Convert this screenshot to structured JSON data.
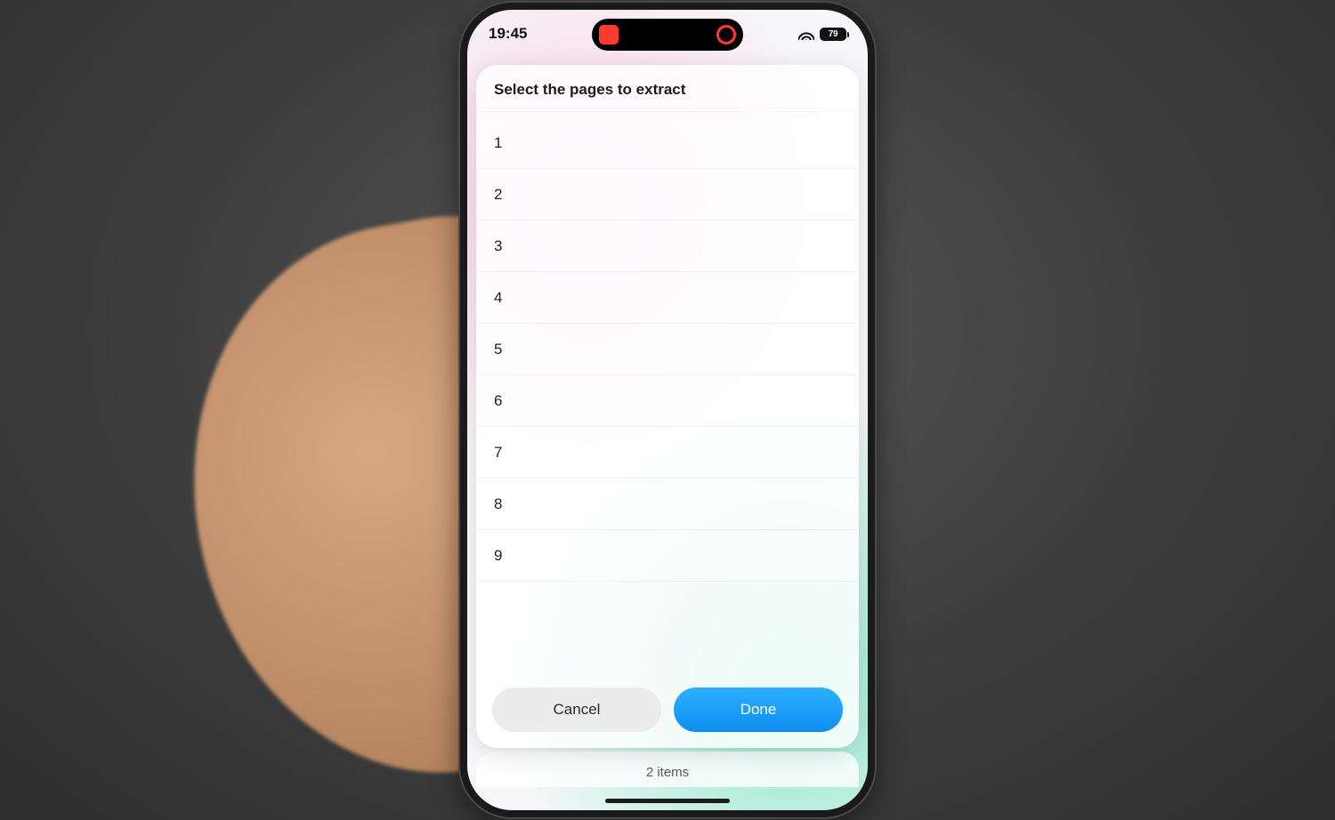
{
  "status": {
    "time": "19:45",
    "battery": "79"
  },
  "modal": {
    "title": "Select the pages to extract",
    "pages": [
      "1",
      "2",
      "3",
      "4",
      "5",
      "6",
      "7",
      "8",
      "9"
    ],
    "cancel": "Cancel",
    "done": "Done"
  },
  "behind": {
    "items_label": "2 items"
  }
}
